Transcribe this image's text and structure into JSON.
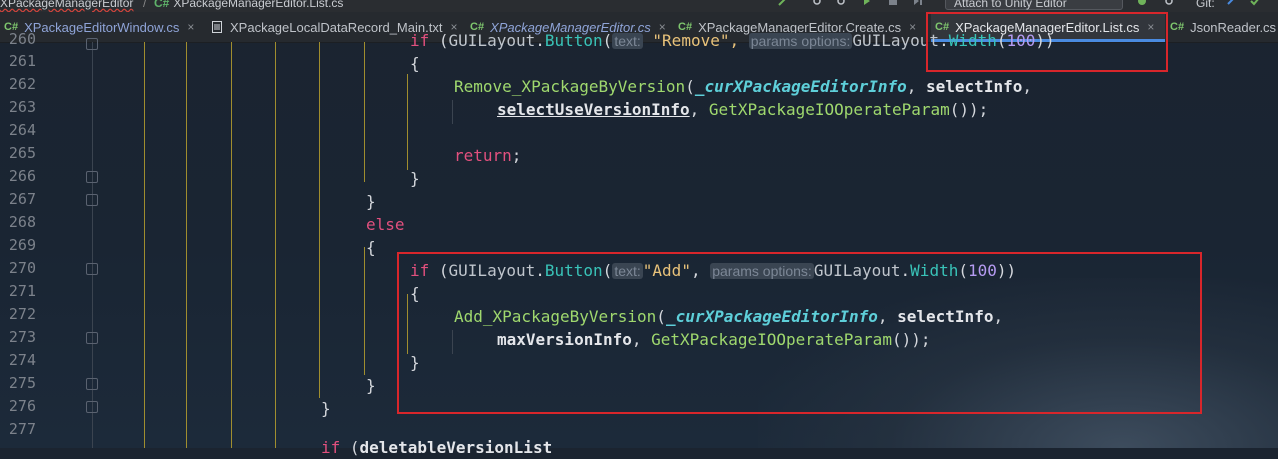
{
  "topbar": {
    "crumb_project": "XPackageManagerEditor",
    "crumb_sep": "/",
    "crumb_cs": "C#",
    "crumb_file": "XPackageManagerEditor.List.cs",
    "attach_label": "Attach to Unity Editor",
    "git_label": "Git:"
  },
  "tabs": [
    {
      "icon": "C#",
      "label": "XPackageEditorWindow.cs",
      "close": "×"
    },
    {
      "icon": "txt",
      "label": "XPackageLocalDataRecord_Main.txt",
      "close": "×"
    },
    {
      "icon": "C#",
      "label": "XPackageManagerEditor.cs",
      "close": "×"
    },
    {
      "icon": "C#",
      "label": "XPackageManagerEditor.Create.cs",
      "close": "×"
    },
    {
      "icon": "C#",
      "label": "XPackageManagerEditor.List.cs",
      "close": "×"
    },
    {
      "icon": "C#",
      "label": "JsonReader.cs",
      "close": ""
    }
  ],
  "line_numbers": [
    "260",
    "261",
    "262",
    "263",
    "264",
    "265",
    "266",
    "267",
    "268",
    "269",
    "270",
    "271",
    "272",
    "273",
    "274",
    "275",
    "276",
    "277"
  ],
  "code": {
    "l260": {
      "kw": "if",
      "p1": " (",
      "cls": "GUILayout",
      "dot": ".",
      "fn": "Button",
      "p2": "(",
      "hint": "text:",
      "s": " \"Remove\",",
      "hint2": "params options:",
      "cls2": "GUILayout",
      "dot2": ".",
      "fn2": "Width",
      "p3": "(",
      "n": "100",
      "p4": "))"
    },
    "l261": "{",
    "l262": {
      "fn": "Remove_XPackageByVersion",
      "p1": "(",
      "v": "_curXPackageEditorInfo",
      "c1": ", ",
      "b": "selectInfo",
      "c2": ","
    },
    "l263": {
      "b": "selectUseVersionInfo",
      "c1": ", ",
      "fn": "GetXPackageIOOperateParam",
      "p": "());"
    },
    "l265": {
      "kw": "return",
      "p": ";"
    },
    "l266": "}",
    "l267": "}",
    "l268": "else",
    "l269": "{",
    "l270": {
      "kw": "if",
      "p1": " (",
      "cls": "GUILayout",
      "dot": ".",
      "fn": "Button",
      "p2": "(",
      "hint": "text:",
      "s": "\"Add\"",
      "c": ", ",
      "hint2": "params options:",
      "cls2": "GUILayout",
      "dot2": ".",
      "fn2": "Width",
      "p3": "(",
      "n": "100",
      "p4": "))"
    },
    "l271": "{",
    "l272": {
      "fn": "Add_XPackageByVersion",
      "p1": "(",
      "v": "_curXPackageEditorInfo",
      "c1": ", ",
      "b": "selectInfo",
      "c2": ","
    },
    "l273": {
      "b": "maxVersionInfo",
      "c1": ", ",
      "fn": "GetXPackageIOOperateParam",
      "p": "());"
    },
    "l274": "}",
    "l275": "}",
    "l276": "}",
    "l277": {
      "a": "if",
      "b": " (",
      "c": "deletable",
      "d": "Vers",
      "e": "ion",
      "f": "List"
    }
  },
  "colors": {
    "highlight_box": "#d8262b",
    "active_tab_underline": "#4a8be0",
    "keyword": "#e2507e",
    "method": "#9fd86e",
    "string": "#e8c27a",
    "number": "#b59bf2"
  }
}
